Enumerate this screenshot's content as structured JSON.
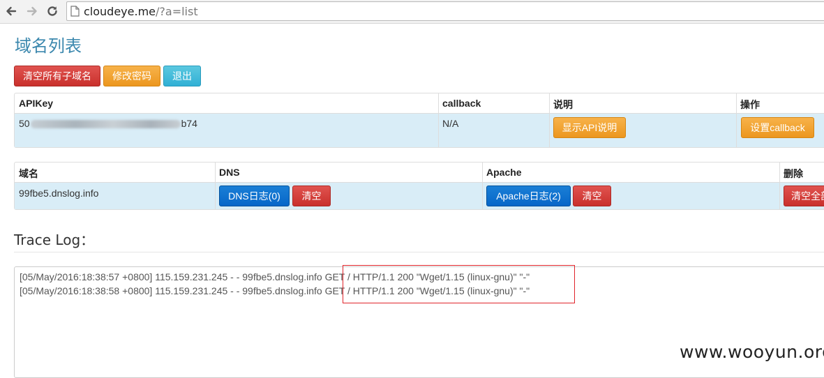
{
  "browser": {
    "url_host": "cloudeye.me",
    "url_path": "/?a=list"
  },
  "page": {
    "title": "域名列表"
  },
  "toolbar": {
    "clear_all_label": "清空所有子域名",
    "change_password_label": "修改密码",
    "logout_label": "退出"
  },
  "api_table": {
    "headers": [
      "APIKey",
      "callback",
      "说明",
      "操作"
    ],
    "row": {
      "apikey_prefix": "50",
      "apikey_suffix": "b74",
      "callback": "N/A",
      "show_api_label": "显示API说明",
      "set_callback_label": "设置callback"
    }
  },
  "domain_table": {
    "headers": [
      "域名",
      "DNS",
      "Apache",
      "删除"
    ],
    "row": {
      "domain": "99fbe5.dnslog.info",
      "dns_log_label": "DNS日志(0)",
      "dns_clear_label": "清空",
      "apache_log_label": "Apache日志(2)",
      "apache_clear_label": "清空",
      "clear_all_label": "清空全部"
    }
  },
  "trace": {
    "title": "Trace Log：",
    "lines": [
      "[05/May/2016:18:38:57 +0800] 115.159.231.245 - - 99fbe5.dnslog.info GET / HTTP/1.1 200 \"Wget/1.15 (linux-gnu)\" \"-\"",
      "[05/May/2016:18:38:58 +0800] 115.159.231.245 - - 99fbe5.dnslog.info GET / HTTP/1.1 200 \"Wget/1.15 (linux-gnu)\" \"-\""
    ]
  },
  "watermark": "www.wooyun.org",
  "colors": {
    "title": "#3a87ad",
    "danger": "#c9302c",
    "warning": "#ec971f",
    "info": "#31b0d5",
    "primary": "#0766c8",
    "row_highlight": "#d9edf7",
    "annotation_box": "#e0242a"
  }
}
